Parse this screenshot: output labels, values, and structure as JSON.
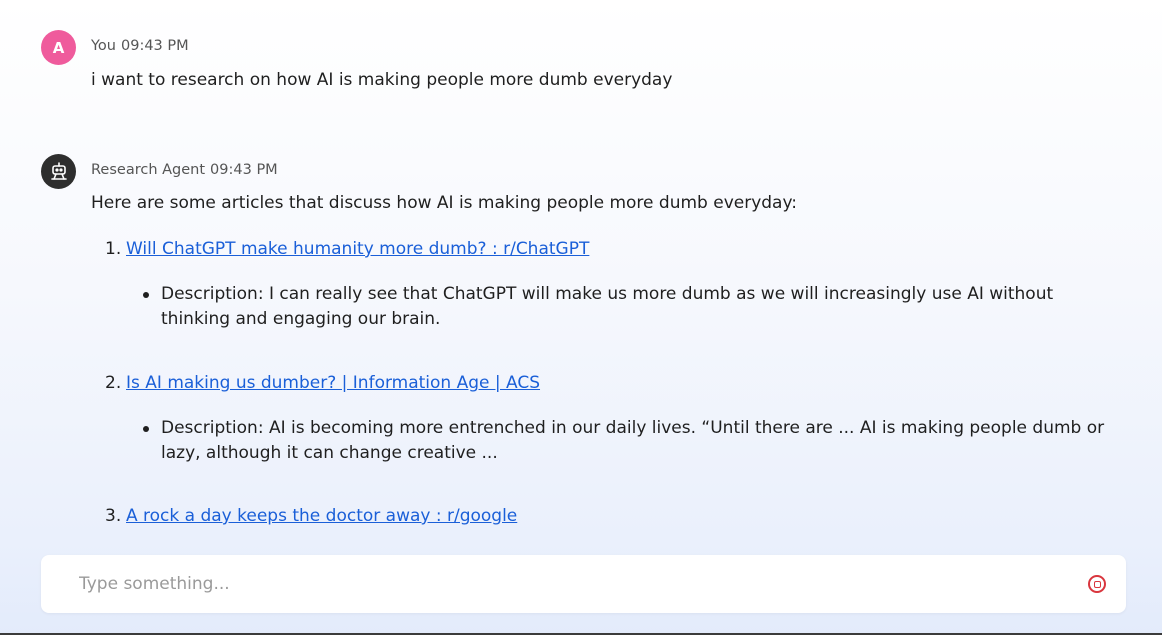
{
  "messages": {
    "user": {
      "avatar_letter": "A",
      "sender": "You",
      "time": "09:43 PM",
      "text": "i want to research on how AI is making people more dumb everyday"
    },
    "agent": {
      "sender": "Research Agent",
      "time": "09:43 PM",
      "intro": "Here are some articles that discuss how AI is making people more dumb everyday:",
      "articles": [
        {
          "number": "1.",
          "title": "Will ChatGPT make humanity more dumb? : r/ChatGPT",
          "description": "Description: I can really see that ChatGPT will make us more dumb as we will increasingly use AI without thinking and engaging our brain."
        },
        {
          "number": "2.",
          "title": "Is AI making us dumber? | Information Age | ACS",
          "description": "Description: AI is becoming more entrenched in our daily lives. “Until there are ... AI is making people dumb or lazy, although it can change creative ..."
        },
        {
          "number": "3.",
          "title": "A rock a day keeps the doctor away : r/google"
        }
      ]
    }
  },
  "composer": {
    "placeholder": "Type something...",
    "value": "",
    "stop_icon": "stop-circle-icon",
    "stop_color": "#d9363e"
  },
  "colors": {
    "user_avatar": "#ef5b9c",
    "agent_avatar": "#2e2e2e",
    "link": "#1a5fd8"
  }
}
